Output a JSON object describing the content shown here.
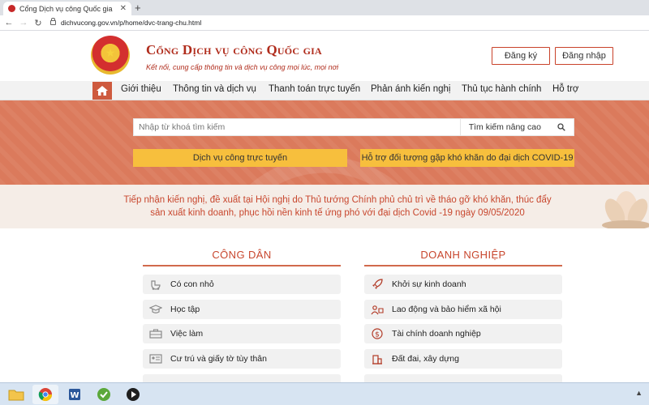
{
  "browser": {
    "tab_title": "Cổng Dịch vụ công Quốc gia",
    "new_tab": "+",
    "url": "dichvucong.gov.vn/p/home/dvc-trang-chu.html"
  },
  "header": {
    "title": "Cổng Dịch vụ công Quốc gia",
    "slogan": "Kết nối, cung cấp thông tin và dịch vụ công mọi lúc, mọi nơi",
    "register_label": "Đăng ký",
    "login_label": "Đăng nhập"
  },
  "nav": {
    "items": [
      {
        "label": "Giới thiệu"
      },
      {
        "label": "Thông tin và dịch vụ"
      },
      {
        "label": "Thanh toán trực tuyến"
      },
      {
        "label": "Phản ánh kiến nghị"
      },
      {
        "label": "Thủ tục hành chính"
      },
      {
        "label": "Hỗ trợ"
      }
    ]
  },
  "search": {
    "placeholder": "Nhập từ khoá tìm kiếm",
    "advanced_label": "Tìm kiếm nâng cao"
  },
  "cta": {
    "online_services": "Dịch vụ công trực tuyến",
    "covid_support": "Hỗ trợ đối tượng gặp khó khăn do đại dịch COVID-19"
  },
  "announcement": {
    "line1": "Tiếp nhận kiến nghị, đề xuất tại Hội nghị do Thủ tướng Chính phủ chủ trì về tháo gỡ khó khăn, thúc đẩy",
    "line2": "sản xuất kinh doanh, phục hồi nền kinh tế ứng phó với đại dịch Covid -19 ngày 09/05/2020"
  },
  "citizen": {
    "title": "CÔNG DÂN",
    "items": [
      {
        "label": "Có con nhỏ",
        "icon": "baby-stroller-icon"
      },
      {
        "label": "Học tập",
        "icon": "graduation-cap-icon"
      },
      {
        "label": "Việc làm",
        "icon": "briefcase-icon"
      },
      {
        "label": "Cư trú và giấy tờ tùy thân",
        "icon": "id-card-icon"
      }
    ]
  },
  "business": {
    "title": "DOANH NGHIỆP",
    "items": [
      {
        "label": "Khởi sự kinh doanh",
        "icon": "rocket-icon"
      },
      {
        "label": "Lao động và bảo hiểm xã hội",
        "icon": "labor-insurance-icon"
      },
      {
        "label": "Tài chính doanh nghiệp",
        "icon": "dollar-icon"
      },
      {
        "label": "Đất đai, xây dựng",
        "icon": "building-icon"
      }
    ]
  },
  "colors": {
    "brand_red": "#b02c1c",
    "accent_orange": "#db7a5c",
    "cta_yellow": "#f7bf3d"
  }
}
